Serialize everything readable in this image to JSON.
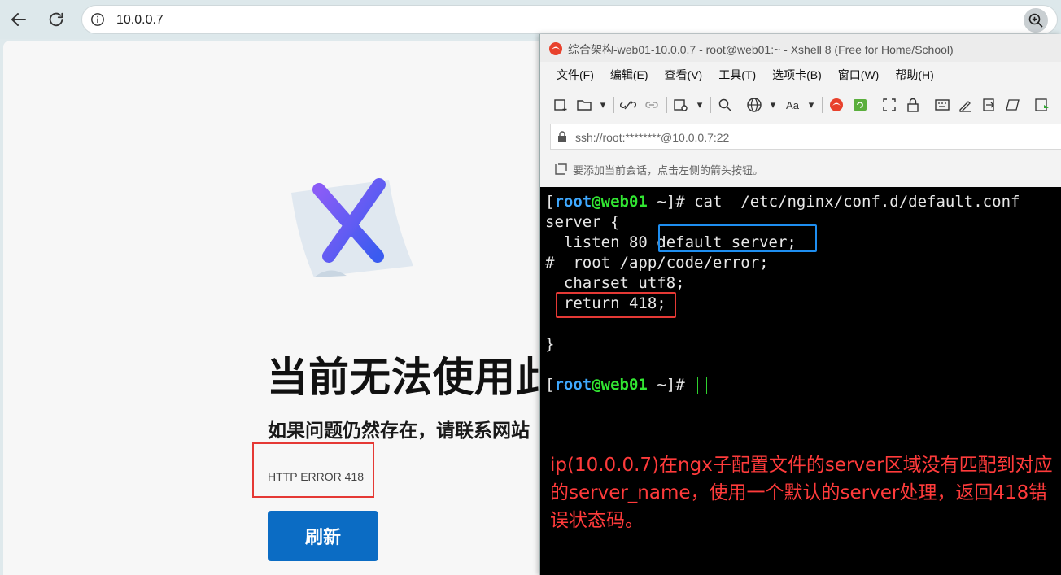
{
  "browser": {
    "url": "10.0.0.7",
    "error_title": "当前无法使用此",
    "error_subtitle": "如果问题仍然存在，请联系网站",
    "error_code": "HTTP ERROR 418",
    "refresh_label": "刷新"
  },
  "xshell": {
    "title": "综合架构-web01-10.0.0.7 - root@web01:~ - Xshell 8 (Free for Home/School)",
    "menu": [
      "文件(F)",
      "编辑(E)",
      "查看(V)",
      "工具(T)",
      "选项卡(B)",
      "窗口(W)",
      "帮助(H)"
    ],
    "ssh_address": "ssh://root:********@10.0.0.7:22",
    "hint": "要添加当前会话，点击左侧的箭头按钮。",
    "terminal": {
      "prompt_open": "[",
      "prompt_user": "root",
      "prompt_host": "web01",
      "prompt_close": " ~]# ",
      "command": "cat  /etc/nginx/conf.d/default.conf",
      "lines": [
        "server {",
        "  listen 80 default_server;",
        "#  root /app/code/error;",
        "  charset utf8;",
        "  return 418;",
        "",
        "}"
      ]
    },
    "annotation": "ip(10.0.0.7)在ngx子配置文件的server区域没有匹配到对应的server_name，使用一个默认的server处理，返回418错误状态码。"
  },
  "colors": {
    "prompt_user": "#3fa9ff",
    "prompt_host": "#32e632",
    "annotation": "#ff3b3b",
    "refresh_button": "#0b6cc4",
    "highlight_red": "#e53935",
    "highlight_blue": "#1e8ef0"
  }
}
